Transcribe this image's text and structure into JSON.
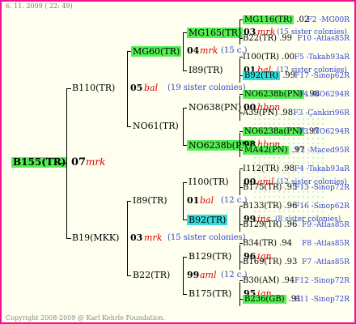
{
  "header": {
    "date": "6. 11. 2009 ( 22: 49)"
  },
  "footer": {
    "copyright": "Copyright 2008-2009 @ Karl Kehrle Foundation."
  },
  "tree": {
    "root": {
      "name": "B155(TR)"
    },
    "gen1": {
      "year": "07",
      "code": "mrk"
    },
    "p_top": {
      "name": "B110(TR)",
      "year": "05",
      "code": "bal",
      "sisters": "(19 sister colonies)"
    },
    "p_bot": {
      "name": "B19(MKK)",
      "year": "03",
      "code": "mrk",
      "sisters": "(15 sister colonies)"
    },
    "mg60": {
      "name": "MG60(TR)",
      "year": "04",
      "code": "mrk",
      "sisters": "(15 c.)"
    },
    "no61": {
      "name": "NO61(TR)"
    },
    "i89a": {
      "name": "I89(TR)",
      "year": "01",
      "code": "bal",
      "sisters": "(12 c.)"
    },
    "b22": {
      "name": "B22(TR)",
      "year": "99",
      "code": "aml",
      "sisters": "(12 c.)"
    },
    "mg165": {
      "name": "MG165(TR)",
      "year": "03",
      "code": "mrk",
      "sisters": "(15 sister colonies)"
    },
    "i89b": {
      "name": "I89(TR)",
      "year": "01",
      "code": "bal",
      "sisters": "(12 sister colonies)"
    },
    "no638": {
      "name": "NO638(PN)",
      "year": "00",
      "code": "hbpn"
    },
    "no6238b": {
      "name": "NO6238b(PN)",
      "year": "98",
      "code": "hbpn"
    },
    "i100": {
      "name": "I100(TR)",
      "year": "00",
      "code": "aml",
      "sisters": "(12 sister colonies)"
    },
    "b92": {
      "name": "B92(TR)",
      "year": "99",
      "code": "ins",
      "sisters": "(8 sister colonies)"
    },
    "b129": {
      "name": "B129(TR)",
      "year": "96",
      "code": "ign"
    },
    "b175": {
      "name": "B175(TR)",
      "year": "95",
      "code": "ign"
    },
    "leaves": [
      {
        "name": "MG116(TR)",
        "score": ".02",
        "hl": "g",
        "ref": "F2 -MG00R"
      },
      {
        "name": "B22(TR)",
        "score": ".99",
        "hl": "",
        "ref": "F10 -Atlas85R"
      },
      {
        "name": "I100(TR)",
        "score": ".00",
        "hl": "",
        "ref": "F5 -Takab93aR"
      },
      {
        "name": "B92(TR)",
        "score": ".99",
        "hl": "c",
        "ref": "F17 -Sinop62R"
      },
      {
        "name": "NO6238b(PN)",
        "score": ".98",
        "hl": "g",
        "ref": "F4 -NO6294R"
      },
      {
        "name": "A39(PN)",
        "score": ".98",
        "hl": "",
        "ref": "F3 -Çankiri96R"
      },
      {
        "name": "NO6238a(PN)",
        "score": ".97",
        "hl": "g",
        "ref": "F3 -NO6294R"
      },
      {
        "name": "MA42(PN)",
        "score": ".97",
        "hl": "g",
        "ref": "F2 -Maced95R"
      },
      {
        "name": "I112(TR)",
        "score": ".98",
        "hl": "",
        "ref": "F4 -Takab93aR"
      },
      {
        "name": "B175(TR)",
        "score": ".95",
        "hl": "",
        "ref": "F13 -Sinop72R"
      },
      {
        "name": "B133(TR)",
        "score": ".96",
        "hl": "",
        "ref": "F16 -Sinop62R"
      },
      {
        "name": "B129(TR)",
        "score": ".96",
        "hl": "",
        "ref": "F9 -Atlas85R"
      },
      {
        "name": "B34(TR)",
        "score": ".94",
        "hl": "",
        "ref": "F8 -Atlas85R"
      },
      {
        "name": "B169(TR)",
        "score": ".93",
        "hl": "",
        "ref": "F7 -Atlas85R"
      },
      {
        "name": "B30(AM)",
        "score": ".94",
        "hl": "",
        "ref": "F12 -Sinop72R"
      },
      {
        "name": "B236(GB)",
        "score": ".91",
        "hl": "g",
        "ref": "F11 -Sinop72R"
      }
    ]
  },
  "colors": {
    "border": "#ee1199",
    "green": "#55ee55",
    "cyan": "#33dddd",
    "red": "#dd0000",
    "blue": "#3344cc"
  }
}
